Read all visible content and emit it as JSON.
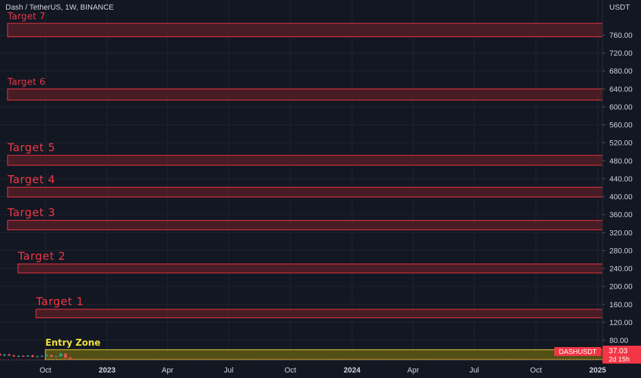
{
  "header": {
    "symbol_title": "Dash / TetherUS, 1W, BINANCE"
  },
  "colors": {
    "background": "#131722",
    "grid": "#1f2430",
    "axis_text": "#d1d4dc",
    "target_line": "#f23645",
    "target_fill": "#5b1f25",
    "target_text": "#f23645",
    "entry_line": "#e6d53b",
    "entry_fill": "#5f5a14",
    "entry_text": "#f0e040",
    "price_tag": "#f23645",
    "candle_up": "#26a69a",
    "candle_down": "#ef5350"
  },
  "chart_data": {
    "type": "bar",
    "y_axis_unit": "USDT",
    "ylim": [
      40,
      800
    ],
    "y_ticks": [
      80,
      120,
      160,
      200,
      240,
      280,
      320,
      360,
      400,
      440,
      480,
      520,
      560,
      600,
      640,
      680,
      720,
      760
    ],
    "y_tick_labels": [
      "80.00",
      "120.00",
      "160.00",
      "200.00",
      "240.00",
      "280.00",
      "320.00",
      "360.00",
      "400.00",
      "440.00",
      "480.00",
      "520.00",
      "560.00",
      "600.00",
      "640.00",
      "680.00",
      "720.00",
      "760.00"
    ],
    "x_ticks": [
      "Oct",
      "2023",
      "Apr",
      "Jul",
      "Oct",
      "2024",
      "Apr",
      "Jul",
      "Oct",
      "2025"
    ],
    "x_tick_dates": [
      "2022-10-01",
      "2023-01-01",
      "2023-04-01",
      "2023-07-01",
      "2023-10-01",
      "2024-01-01",
      "2024-04-01",
      "2024-07-01",
      "2024-10-01",
      "2025-01-01"
    ],
    "zones": [
      {
        "label": "Target 7",
        "low": 756,
        "high": 786,
        "start": "2022-07-25",
        "label_size": "small"
      },
      {
        "label": "Target 6",
        "low": 615,
        "high": 640,
        "start": "2022-07-25",
        "label_size": "small"
      },
      {
        "label": "Target 5",
        "low": 470,
        "high": 492,
        "start": "2022-07-25",
        "label_size": "large"
      },
      {
        "label": "Target 4",
        "low": 399,
        "high": 421,
        "start": "2022-07-25",
        "label_size": "large"
      },
      {
        "label": "Target 3",
        "low": 326,
        "high": 347,
        "start": "2022-07-25",
        "label_size": "large"
      },
      {
        "label": "Target 2",
        "low": 230,
        "high": 250,
        "start": "2022-08-21",
        "label_size": "large"
      },
      {
        "label": "Target 1",
        "low": 130,
        "high": 149,
        "start": "2022-09-17",
        "label_size": "large"
      }
    ],
    "entry_zone": {
      "label": "Entry Zone",
      "low": 37,
      "high": 59,
      "start": "2022-10-01"
    },
    "candles": [
      {
        "date": "2022-05-23",
        "open": 55,
        "high": 62,
        "low": 50,
        "close": 57
      },
      {
        "date": "2022-05-30",
        "open": 57,
        "high": 60,
        "low": 53,
        "close": 55
      },
      {
        "date": "2022-06-06",
        "open": 55,
        "high": 58,
        "low": 48,
        "close": 50
      },
      {
        "date": "2022-06-13",
        "open": 50,
        "high": 56,
        "low": 46,
        "close": 53
      },
      {
        "date": "2022-06-20",
        "open": 53,
        "high": 64,
        "low": 52,
        "close": 62
      },
      {
        "date": "2022-06-27",
        "open": 62,
        "high": 63,
        "low": 50,
        "close": 51
      },
      {
        "date": "2022-07-04",
        "open": 51,
        "high": 54,
        "low": 47,
        "close": 49
      },
      {
        "date": "2022-07-11",
        "open": 49,
        "high": 52,
        "low": 45,
        "close": 47
      },
      {
        "date": "2022-07-18",
        "open": 47,
        "high": 53,
        "low": 46,
        "close": 50
      },
      {
        "date": "2022-07-25",
        "open": 50,
        "high": 52,
        "low": 44,
        "close": 46
      },
      {
        "date": "2022-08-01",
        "open": 46,
        "high": 50,
        "low": 44,
        "close": 48
      },
      {
        "date": "2022-08-08",
        "open": 48,
        "high": 51,
        "low": 45,
        "close": 46
      },
      {
        "date": "2022-08-15",
        "open": 46,
        "high": 48,
        "low": 43,
        "close": 44
      },
      {
        "date": "2022-08-22",
        "open": 44,
        "high": 47,
        "low": 42,
        "close": 45
      },
      {
        "date": "2022-08-29",
        "open": 45,
        "high": 47,
        "low": 43,
        "close": 44
      },
      {
        "date": "2022-09-05",
        "open": 44,
        "high": 47,
        "low": 43,
        "close": 46
      },
      {
        "date": "2022-09-12",
        "open": 46,
        "high": 48,
        "low": 42,
        "close": 43
      },
      {
        "date": "2022-09-19",
        "open": 43,
        "high": 46,
        "low": 42,
        "close": 44
      },
      {
        "date": "2022-09-26",
        "open": 44,
        "high": 47,
        "low": 43,
        "close": 45
      },
      {
        "date": "2022-10-03",
        "open": 45,
        "high": 49,
        "low": 44,
        "close": 47
      },
      {
        "date": "2022-10-10",
        "open": 47,
        "high": 48,
        "low": 42,
        "close": 43
      },
      {
        "date": "2022-10-17",
        "open": 43,
        "high": 46,
        "low": 42,
        "close": 44
      },
      {
        "date": "2022-10-24",
        "open": 44,
        "high": 52,
        "low": 44,
        "close": 50
      },
      {
        "date": "2022-10-31",
        "open": 50,
        "high": 51,
        "low": 40,
        "close": 41
      },
      {
        "date": "2022-11-07",
        "open": 41,
        "high": 44,
        "low": 35,
        "close": 37.03
      }
    ],
    "last_price": {
      "symbol_label": "DASHUSDT",
      "value": 37.03,
      "value_label": "37.03",
      "countdown": "2d 15h"
    }
  }
}
